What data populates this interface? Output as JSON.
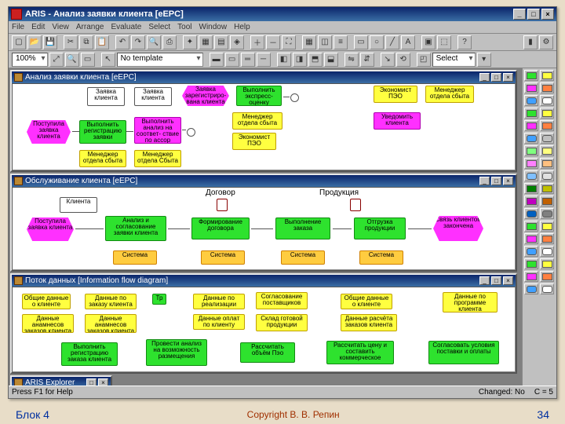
{
  "title": "ARIS - Анализ заявки клиента [eEPC]",
  "menu": [
    "File",
    "Edit",
    "View",
    "Arrange",
    "Evaluate",
    "Select",
    "Tool",
    "Window",
    "Help"
  ],
  "toolbar1_combo": "100%",
  "toolbar2_combo": "No template",
  "toolbar2_select": "Select",
  "panes": [
    {
      "title": "Анализ заявки клиента [eEPC]"
    },
    {
      "title": "Обслуживание клиента [eEPC]"
    },
    {
      "title": "Поток данных [Information flow diagram]"
    },
    {
      "title": "ARIS Explorer"
    }
  ],
  "pane0": {
    "s0": "Заявка\nклиента",
    "s1": "Заявка\nклиента",
    "s2": "Заявка\nзарегистриро-\nвана клиента",
    "s3": "Выполнить\nэкспресс-\nоценку",
    "s4": "Экономист\nПЭО",
    "s5": "Менеджер\nотдела сбыта",
    "s6": "Поступила\nзаявка\nклиента",
    "s7": "Выполнить\nрегистрацию\nзаявки",
    "s8": "Выполнить\nанализ на\nсоответ-\nствие по ассор",
    "s9": "Менеджер\nотдела сбыта",
    "s10": "Экономист\nПЭО",
    "s11": "Уведомить\nклиента",
    "s12": "Менеджер\nотдела сбыта",
    "s13": "Менеджер\nотдела Сбыта"
  },
  "pane1": {
    "h0": "Договор",
    "h1": "Продукция",
    "h2": "Клиента",
    "s0": "Поступила\nзаявка\nклиента",
    "s1": "Анализ и\nсогласование\nзаявки клиента",
    "s2": "Формирование\nдоговора",
    "s3": "Выполнение\nзаказа",
    "s4": "Отгрузка\nпродукции",
    "s5": "Связь\nклиентом\nзакончена",
    "sys": "Система"
  },
  "pane2": {
    "s0": "Общие данные\nо клиенте",
    "s1": "Данные по\nзаказу клиента",
    "s2": "Данные\nанамнесов\nзаказов клиента",
    "s3": "Данные по\nреализации",
    "s4": "Данные оплат\nпо клиенту",
    "s5": "Согласование\nпоставщиков",
    "s6": "Склад готовой\nпродукции",
    "s7": "Общие данные\nо клиенте",
    "s8": "Данные расчёта\nзаказов клиента",
    "s9": "Данные по\nпрограмме\nклиента",
    "f0": "Выполнить\nрегистрацию\nзаказа клиента",
    "f1": "Провести\nанализ на\nвозможность\nразмещения",
    "f2": "Тр",
    "f3": "Рассчитать\nобъём Пэо",
    "f4": "Рассчитать цену\nи составить\nкоммерческое",
    "f5": "Согласовать\nусловия поставки\nи оплаты"
  },
  "status": {
    "left": "Press F1 for Help",
    "mid": "Changed: No",
    "right": "C = 5"
  },
  "palette_colors": [
    "#2ee22e",
    "#ffff40",
    "#ff30ff",
    "#ff8040",
    "#40a0ff",
    "#ffffff",
    "#2ee22e",
    "#ffff40",
    "#ff30ff",
    "#ff8040",
    "#40a0ff",
    "#c0c0c0",
    "#80ff80",
    "#ffff80",
    "#ff80ff",
    "#ffc080",
    "#80c0ff",
    "#e0e0e0",
    "#008000",
    "#c0c000",
    "#c000c0",
    "#c06000",
    "#0060c0",
    "#808080",
    "#2ee22e",
    "#ffff40",
    "#ff30ff",
    "#ff8040",
    "#40a0ff",
    "#ffffff",
    "#2ee22e",
    "#ffff40",
    "#ff30ff",
    "#ff8040",
    "#40a0ff",
    "#ffffff"
  ],
  "slide": {
    "left": "Блок 4",
    "center": "Copyright В. В. Репин",
    "right": "34"
  }
}
